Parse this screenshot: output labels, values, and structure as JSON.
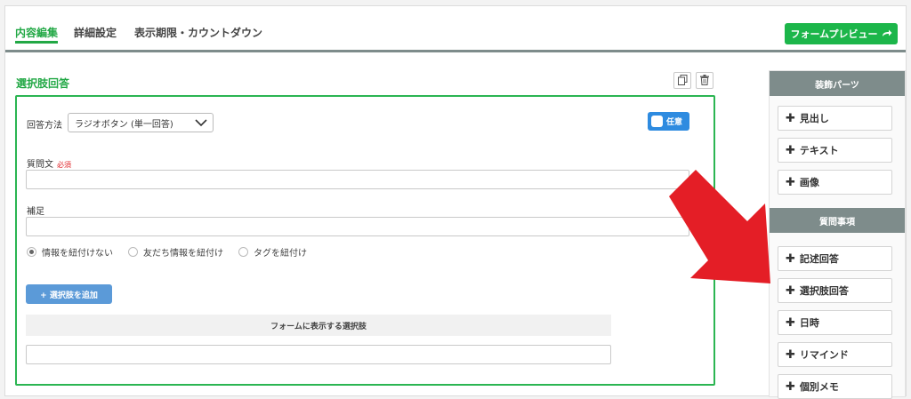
{
  "tabs": [
    {
      "label": "内容編集",
      "active": true
    },
    {
      "label": "詳細設定",
      "active": false
    },
    {
      "label": "表示期限・カウントダウン",
      "active": false
    }
  ],
  "preview_button": "フォームプレビュー",
  "section": {
    "title": "選択肢回答",
    "answer_method_label": "回答方法",
    "answer_method_value": "ラジオボタン (単一回答)",
    "optional_toggle": "任意",
    "question_label": "質問文",
    "required_badge": "必須",
    "question_value": "",
    "supplement_label": "補足",
    "supplement_value": "",
    "link_options": [
      {
        "label": "情報を紐付けない",
        "selected": true
      },
      {
        "label": "友だち情報を紐付け",
        "selected": false
      },
      {
        "label": "タグを紐付け",
        "selected": false
      }
    ],
    "add_choice_button": "+ 選択肢を追加",
    "choices_header": "フォームに表示する選択肢",
    "choice_value": ""
  },
  "panel": {
    "decor_head": "装飾パーツ",
    "decor_items": [
      "見出し",
      "テキスト",
      "画像"
    ],
    "question_head": "質問事項",
    "question_items": [
      "記述回答",
      "選択肢回答",
      "日時",
      "リマインド",
      "個別メモ"
    ]
  },
  "colors": {
    "accent": "#22a845",
    "button_green": "#1cb64a",
    "panel_head": "#7e8c8b",
    "toggle_blue": "#2e8be0",
    "arrow_red": "#e41e26"
  }
}
